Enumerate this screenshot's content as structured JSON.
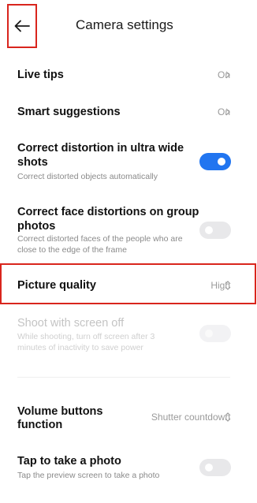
{
  "header": {
    "title": "Camera settings"
  },
  "settings": {
    "live_tips": {
      "label": "Live tips",
      "value": "On"
    },
    "smart_suggestions": {
      "label": "Smart suggestions",
      "value": "On"
    },
    "correct_distortion": {
      "label_line1": "Correct distortion in ultra wide",
      "label_line2": "shots",
      "sub": "Correct distorted objects automatically",
      "enabled": true
    },
    "face_distortion": {
      "label_line1": "Correct face distortions on group",
      "label_line2": "photos",
      "sub_line1": "Correct distorted faces of the people who are",
      "sub_line2": "close to the edge of the frame",
      "enabled": false
    },
    "picture_quality": {
      "label": "Picture quality",
      "value": "High"
    },
    "screen_off": {
      "label": "Shoot with screen off",
      "sub_line1": "While shooting, turn off screen after 3",
      "sub_line2": "minutes of inactivity to save power",
      "enabled": false,
      "disabled": true
    },
    "volume_buttons": {
      "label_line1": "Volume buttons",
      "label_line2": "function",
      "value": "Shutter countdown"
    },
    "tap_photo": {
      "label": "Tap to take a photo",
      "sub": "Tap the preview screen to take a photo",
      "enabled": false
    }
  },
  "colors": {
    "accent": "#2175f0",
    "highlight_border": "#d9251d"
  }
}
